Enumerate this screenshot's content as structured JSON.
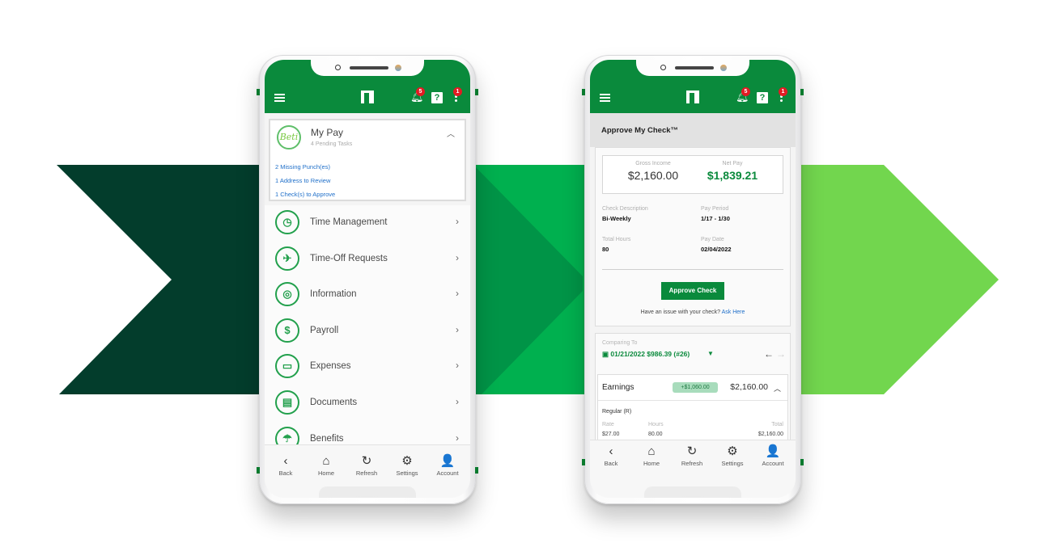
{
  "colors": {
    "dark_green": "#033d2c",
    "mid_green": "#00b04f",
    "mid_green_shade": "#009447",
    "light_green": "#72d64e",
    "brand_green": "#0a8a3c",
    "badge_red": "#e21b23",
    "link_blue": "#1f6fc9"
  },
  "header": {
    "icons": [
      "hamburger-menu-icon",
      "paycom-logo-icon",
      "bell-icon",
      "help-icon",
      "kebab-menu-icon"
    ],
    "notifications_badge": "5",
    "more_badge": "1",
    "help_glyph": "?"
  },
  "left_phone": {
    "my_pay": {
      "avatar_text": "Beti",
      "title": "My Pay",
      "subtitle": "4 Pending Tasks",
      "tasks": [
        "2 Missing Punch(es)",
        "1 Address to Review",
        "1 Check(s) to Approve"
      ]
    },
    "menu": [
      {
        "label": "Time Management",
        "icon": "clock-icon",
        "glyph": "◷"
      },
      {
        "label": "Time-Off Requests",
        "icon": "suitcase-icon",
        "glyph": "✈"
      },
      {
        "label": "Information",
        "icon": "fingerprint-icon",
        "glyph": "◎"
      },
      {
        "label": "Payroll",
        "icon": "dollar-bag-icon",
        "glyph": "$"
      },
      {
        "label": "Expenses",
        "icon": "credit-card-icon",
        "glyph": "▭"
      },
      {
        "label": "Documents",
        "icon": "document-icon",
        "glyph": "▤"
      },
      {
        "label": "Benefits",
        "icon": "umbrella-icon",
        "glyph": "☂"
      }
    ]
  },
  "right_phone": {
    "section_title": "Approve My Check™",
    "gross_label": "Gross Income",
    "gross_value": "$2,160.00",
    "net_label": "Net Pay",
    "net_value": "$1,839.21",
    "check_description_label": "Check Description",
    "check_description_value": "Bi-Weekly",
    "pay_period_label": "Pay Period",
    "pay_period_value": "1/17 - 1/30",
    "total_hours_label": "Total Hours",
    "total_hours_value": "80",
    "pay_date_label": "Pay Date",
    "pay_date_value": "02/04/2022",
    "approve_button": "Approve Check",
    "issue_text": "Have an issue with your check?",
    "issue_link": "Ask Here",
    "comparing_label": "Comparing To",
    "comparing_value": "01/21/2022 $986.39 (#26)",
    "earnings": {
      "title": "Earnings",
      "delta": "+$1,060.00",
      "total": "$2,160.00",
      "line_name": "Regular (R)",
      "rate_label": "Rate",
      "rate_value": "$27.00",
      "hours_label": "Hours",
      "hours_value": "80.00",
      "total_label": "Total",
      "total_value": "$2,160.00"
    }
  },
  "bottom_nav": [
    {
      "label": "Back",
      "icon": "back-chevron-icon",
      "glyph": "‹"
    },
    {
      "label": "Home",
      "icon": "home-icon",
      "glyph": "⌂"
    },
    {
      "label": "Refresh",
      "icon": "refresh-icon",
      "glyph": "↻"
    },
    {
      "label": "Settings",
      "icon": "gear-icon",
      "glyph": "⚙"
    },
    {
      "label": "Account",
      "icon": "account-icon",
      "glyph": "👤"
    }
  ]
}
